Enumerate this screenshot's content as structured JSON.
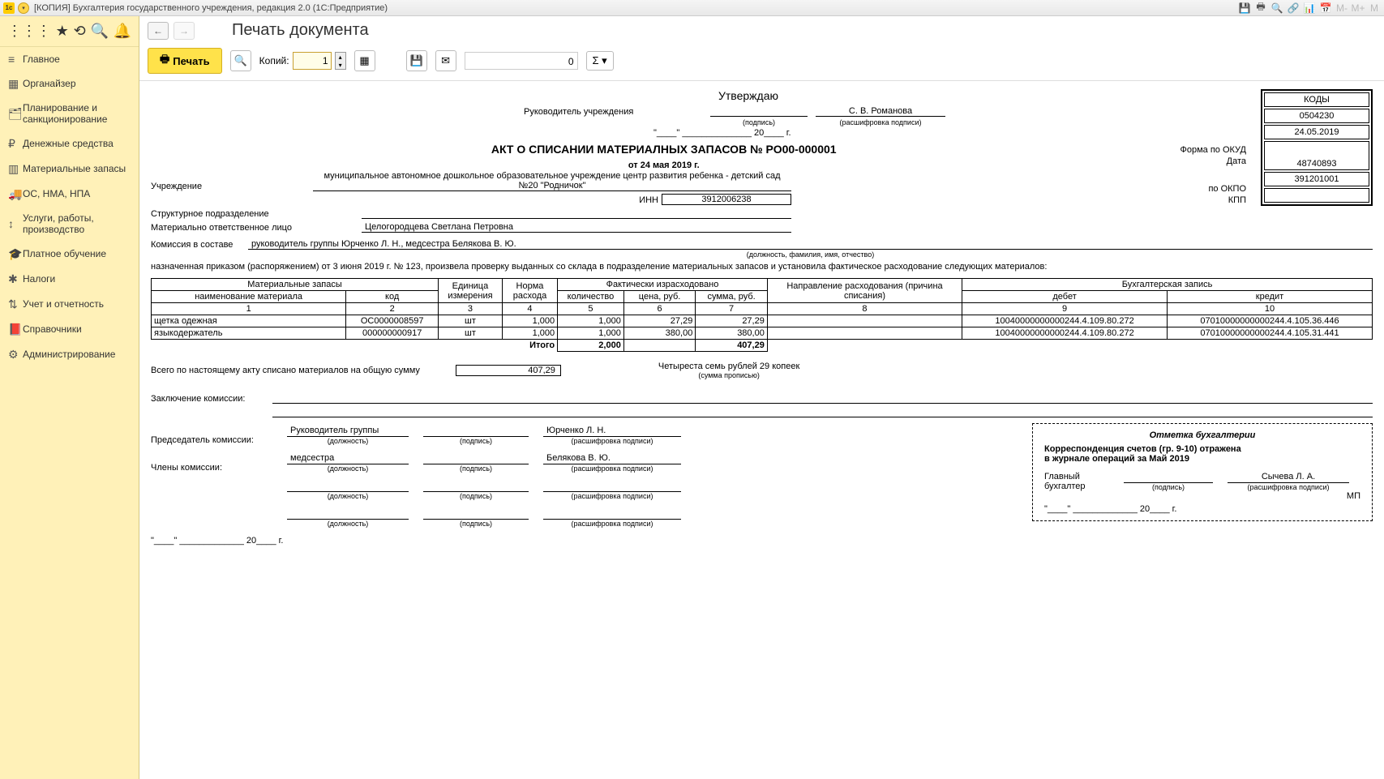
{
  "window": {
    "title": "[КОПИЯ] Бухгалтерия государственного учреждения, редакция 2.0  (1С:Предприятие)"
  },
  "sidebar": {
    "items": [
      {
        "icon": "≡",
        "label": "Главное"
      },
      {
        "icon": "▦",
        "label": "Органайзер"
      },
      {
        "icon": "🗂",
        "label": "Планирование и санкционирование"
      },
      {
        "icon": "₽",
        "label": "Денежные средства"
      },
      {
        "icon": "▥",
        "label": "Материальные запасы"
      },
      {
        "icon": "🚚",
        "label": "ОС, НМА, НПА"
      },
      {
        "icon": "↕",
        "label": "Услуги, работы, производство"
      },
      {
        "icon": "🎓",
        "label": "Платное обучение"
      },
      {
        "icon": "✱",
        "label": "Налоги"
      },
      {
        "icon": "⇅",
        "label": "Учет и отчетность"
      },
      {
        "icon": "📕",
        "label": "Справочники"
      },
      {
        "icon": "⚙",
        "label": "Администрирование"
      }
    ]
  },
  "page": {
    "title": "Печать документа"
  },
  "toolbar": {
    "print": "Печать",
    "copies_label": "Копий:",
    "copies_value": "1",
    "page_indicator": "0"
  },
  "doc": {
    "approve": "Утверждаю",
    "head_position_label": "Руководитель учреждения",
    "head_name": "С. В. Романова",
    "sig_caption": "(подпись)",
    "name_caption": "(расшифровка подписи)",
    "year_suffix": "20____ г.",
    "title": "АКТ О СПИСАНИИ МАТЕРИАЛНЫХ ЗАПАСОВ  № РО00-000001",
    "date": "от 24 мая 2019 г.",
    "codes": {
      "header": "КОДЫ",
      "okud_lbl": "Форма  по ОКУД",
      "okud": "0504230",
      "date_lbl": "Дата",
      "date": "24.05.2019",
      "okpo_lbl": "по ОКПО",
      "okpo": "48740893",
      "kpp_lbl": "КПП",
      "kpp": "391201001"
    },
    "org_lbl": "Учреждение",
    "org": "муниципальное автономное дошкольное образовательное учреждение центр развития ребенка - детский сад №20 \"Родничок\"",
    "inn_lbl": "ИНН",
    "inn": "3912006238",
    "unit_lbl": "Структурное подразделение",
    "resp_lbl": "Материально ответственное лицо",
    "resp": "Целогородцева Светлана Петровна",
    "commission_lbl": "Комиссия в составе",
    "commission": "руководитель группы Юрченко Л. Н., медсестра Белякова  В. Ю.",
    "commission_caption": "(должность, фамилия, имя, отчество)",
    "order_text": "назначенная приказом (распоряжением)  от  3 июня 2019 г. №  123, произвела проверку выданных со склада в подразделение материальных запасов и установила фактическое расходование следующих материалов:",
    "headers": {
      "mat": "Материальные запасы",
      "unit": "Единица измерения",
      "norm": "Норма расхода",
      "fact": "Фактически израсходовано",
      "dir": "Направление расходования (причина списания)",
      "acc": "Бухгалтерская запись",
      "name": "наименование материала",
      "code": "код",
      "qty": "количество",
      "price": "цена, руб.",
      "sum": "сумма, руб.",
      "debit": "дебет",
      "credit": "кредит",
      "itogo": "Итого"
    },
    "nums": [
      "1",
      "2",
      "3",
      "4",
      "5",
      "6",
      "7",
      "8",
      "9",
      "10"
    ],
    "rows": [
      {
        "name": "щетка одежная",
        "code": "ОС0000008597",
        "unit": "шт",
        "norm": "1,000",
        "qty": "1,000",
        "price": "27,29",
        "sum": "27,29",
        "dir": "",
        "debit": "10040000000000244.4.109.80.272",
        "credit": "07010000000000244.4.105.36.446"
      },
      {
        "name": "языкодержатель",
        "code": "000000000917",
        "unit": "шт",
        "norm": "1,000",
        "qty": "1,000",
        "price": "380,00",
        "sum": "380,00",
        "dir": "",
        "debit": "10040000000000244.4.109.80.272",
        "credit": "07010000000000244.4.105.31.441"
      }
    ],
    "totals": {
      "qty": "2,000",
      "sum": "407,29"
    },
    "total_text": "Всего по настоящему акту списано материалов на общую сумму",
    "total_sum": "407,29",
    "total_words": "Четыреста семь рублей 29 копеек",
    "total_words_caption": "(сумма прописью)",
    "conclusion_lbl": "Заключение комиссии:",
    "chairman_lbl": "Председатель комиссии:",
    "chairman_pos": "Руководитель группы",
    "chairman_name": "Юрченко Л. Н.",
    "members_lbl": "Члены комиссии:",
    "member1_pos": "медсестра",
    "member1_name": "Белякова  В. Ю.",
    "pos_caption": "(должность)",
    "accounting": {
      "title": "Отметка бухгалтерии",
      "line1": "Корреспонденция счетов (гр. 9-10) отражена",
      "line2": "в журнале операций за Май 2019",
      "chief_lbl": "Главный бухгалтер",
      "chief_name": "Сычева Л. А.",
      "mp": "МП"
    }
  }
}
